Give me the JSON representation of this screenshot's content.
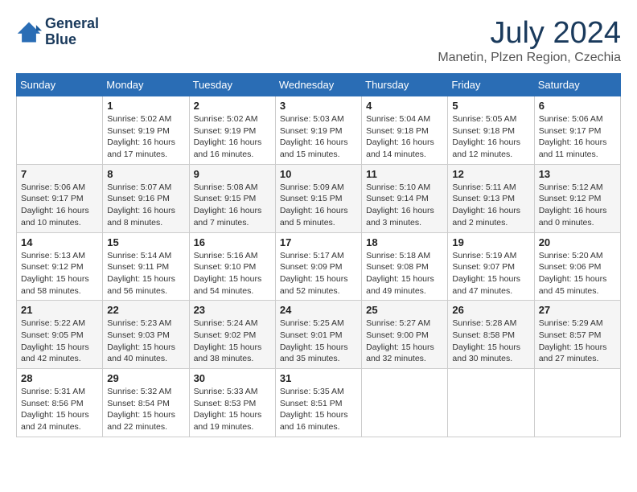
{
  "header": {
    "logo_line1": "General",
    "logo_line2": "Blue",
    "month_year": "July 2024",
    "location": "Manetin, Plzen Region, Czechia"
  },
  "weekdays": [
    "Sunday",
    "Monday",
    "Tuesday",
    "Wednesday",
    "Thursday",
    "Friday",
    "Saturday"
  ],
  "weeks": [
    [
      {
        "day": "",
        "info": ""
      },
      {
        "day": "1",
        "info": "Sunrise: 5:02 AM\nSunset: 9:19 PM\nDaylight: 16 hours\nand 17 minutes."
      },
      {
        "day": "2",
        "info": "Sunrise: 5:02 AM\nSunset: 9:19 PM\nDaylight: 16 hours\nand 16 minutes."
      },
      {
        "day": "3",
        "info": "Sunrise: 5:03 AM\nSunset: 9:19 PM\nDaylight: 16 hours\nand 15 minutes."
      },
      {
        "day": "4",
        "info": "Sunrise: 5:04 AM\nSunset: 9:18 PM\nDaylight: 16 hours\nand 14 minutes."
      },
      {
        "day": "5",
        "info": "Sunrise: 5:05 AM\nSunset: 9:18 PM\nDaylight: 16 hours\nand 12 minutes."
      },
      {
        "day": "6",
        "info": "Sunrise: 5:06 AM\nSunset: 9:17 PM\nDaylight: 16 hours\nand 11 minutes."
      }
    ],
    [
      {
        "day": "7",
        "info": "Sunrise: 5:06 AM\nSunset: 9:17 PM\nDaylight: 16 hours\nand 10 minutes."
      },
      {
        "day": "8",
        "info": "Sunrise: 5:07 AM\nSunset: 9:16 PM\nDaylight: 16 hours\nand 8 minutes."
      },
      {
        "day": "9",
        "info": "Sunrise: 5:08 AM\nSunset: 9:15 PM\nDaylight: 16 hours\nand 7 minutes."
      },
      {
        "day": "10",
        "info": "Sunrise: 5:09 AM\nSunset: 9:15 PM\nDaylight: 16 hours\nand 5 minutes."
      },
      {
        "day": "11",
        "info": "Sunrise: 5:10 AM\nSunset: 9:14 PM\nDaylight: 16 hours\nand 3 minutes."
      },
      {
        "day": "12",
        "info": "Sunrise: 5:11 AM\nSunset: 9:13 PM\nDaylight: 16 hours\nand 2 minutes."
      },
      {
        "day": "13",
        "info": "Sunrise: 5:12 AM\nSunset: 9:12 PM\nDaylight: 16 hours\nand 0 minutes."
      }
    ],
    [
      {
        "day": "14",
        "info": "Sunrise: 5:13 AM\nSunset: 9:12 PM\nDaylight: 15 hours\nand 58 minutes."
      },
      {
        "day": "15",
        "info": "Sunrise: 5:14 AM\nSunset: 9:11 PM\nDaylight: 15 hours\nand 56 minutes."
      },
      {
        "day": "16",
        "info": "Sunrise: 5:16 AM\nSunset: 9:10 PM\nDaylight: 15 hours\nand 54 minutes."
      },
      {
        "day": "17",
        "info": "Sunrise: 5:17 AM\nSunset: 9:09 PM\nDaylight: 15 hours\nand 52 minutes."
      },
      {
        "day": "18",
        "info": "Sunrise: 5:18 AM\nSunset: 9:08 PM\nDaylight: 15 hours\nand 49 minutes."
      },
      {
        "day": "19",
        "info": "Sunrise: 5:19 AM\nSunset: 9:07 PM\nDaylight: 15 hours\nand 47 minutes."
      },
      {
        "day": "20",
        "info": "Sunrise: 5:20 AM\nSunset: 9:06 PM\nDaylight: 15 hours\nand 45 minutes."
      }
    ],
    [
      {
        "day": "21",
        "info": "Sunrise: 5:22 AM\nSunset: 9:05 PM\nDaylight: 15 hours\nand 42 minutes."
      },
      {
        "day": "22",
        "info": "Sunrise: 5:23 AM\nSunset: 9:03 PM\nDaylight: 15 hours\nand 40 minutes."
      },
      {
        "day": "23",
        "info": "Sunrise: 5:24 AM\nSunset: 9:02 PM\nDaylight: 15 hours\nand 38 minutes."
      },
      {
        "day": "24",
        "info": "Sunrise: 5:25 AM\nSunset: 9:01 PM\nDaylight: 15 hours\nand 35 minutes."
      },
      {
        "day": "25",
        "info": "Sunrise: 5:27 AM\nSunset: 9:00 PM\nDaylight: 15 hours\nand 32 minutes."
      },
      {
        "day": "26",
        "info": "Sunrise: 5:28 AM\nSunset: 8:58 PM\nDaylight: 15 hours\nand 30 minutes."
      },
      {
        "day": "27",
        "info": "Sunrise: 5:29 AM\nSunset: 8:57 PM\nDaylight: 15 hours\nand 27 minutes."
      }
    ],
    [
      {
        "day": "28",
        "info": "Sunrise: 5:31 AM\nSunset: 8:56 PM\nDaylight: 15 hours\nand 24 minutes."
      },
      {
        "day": "29",
        "info": "Sunrise: 5:32 AM\nSunset: 8:54 PM\nDaylight: 15 hours\nand 22 minutes."
      },
      {
        "day": "30",
        "info": "Sunrise: 5:33 AM\nSunset: 8:53 PM\nDaylight: 15 hours\nand 19 minutes."
      },
      {
        "day": "31",
        "info": "Sunrise: 5:35 AM\nSunset: 8:51 PM\nDaylight: 15 hours\nand 16 minutes."
      },
      {
        "day": "",
        "info": ""
      },
      {
        "day": "",
        "info": ""
      },
      {
        "day": "",
        "info": ""
      }
    ]
  ]
}
